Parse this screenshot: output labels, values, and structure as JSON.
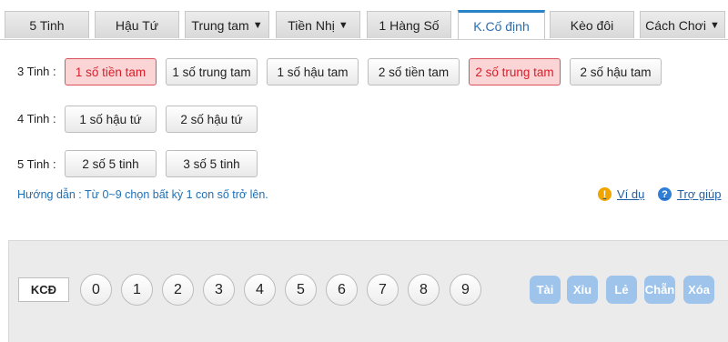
{
  "tabs": [
    {
      "label": "5 Tinh",
      "dropdown": false
    },
    {
      "label": "Hậu Tứ",
      "dropdown": false
    },
    {
      "label": "Trung tam",
      "dropdown": true
    },
    {
      "label": "Tiền Nhị",
      "dropdown": true
    },
    {
      "label": "1 Hàng Số",
      "dropdown": false
    },
    {
      "label": "K.Cố định",
      "dropdown": false,
      "active": true
    },
    {
      "label": "Kèo đôi",
      "dropdown": false
    },
    {
      "label": "Cách Chơi",
      "dropdown": true
    }
  ],
  "rows": {
    "r3": {
      "label": "3 Tinh :",
      "options": [
        "1 số tiền tam",
        "1 số trung tam",
        "1 số hậu tam",
        "2 số tiền tam",
        "2 số trung tam",
        "2 số hậu tam"
      ],
      "selected": [
        "1 số tiền tam",
        "2 số trung tam"
      ]
    },
    "r4": {
      "label": "4 Tinh :",
      "options": [
        "1 số hậu tứ",
        "2 số hậu tứ"
      ]
    },
    "r5": {
      "label": "5 Tinh :",
      "options": [
        "2 số 5 tinh",
        "3 số 5 tinh"
      ]
    }
  },
  "guide": "Hướng dẫn : Từ 0~9 chọn bất kỳ 1 con số trở lên.",
  "links": {
    "example": "Ví dụ",
    "help": "Trợ giúp"
  },
  "picker": {
    "label": "KCĐ",
    "numbers": [
      "0",
      "1",
      "2",
      "3",
      "4",
      "5",
      "6",
      "7",
      "8",
      "9"
    ],
    "quick": [
      "Tài",
      "Xỉu",
      "Lẻ",
      "Chẵn",
      "Xóa"
    ]
  },
  "colors": {
    "accent": "#2a83c4",
    "selected_bg": "#fbd4d6",
    "selected_text": "#d81e2a",
    "guide_text": "#1f6fb5",
    "quick_button": "#9ec4ec",
    "example_icon": "#f0a400",
    "help_icon": "#2f7fd6"
  },
  "icons": {
    "caret": "caret-down-icon",
    "example": "exclamation-icon",
    "help": "question-icon"
  }
}
